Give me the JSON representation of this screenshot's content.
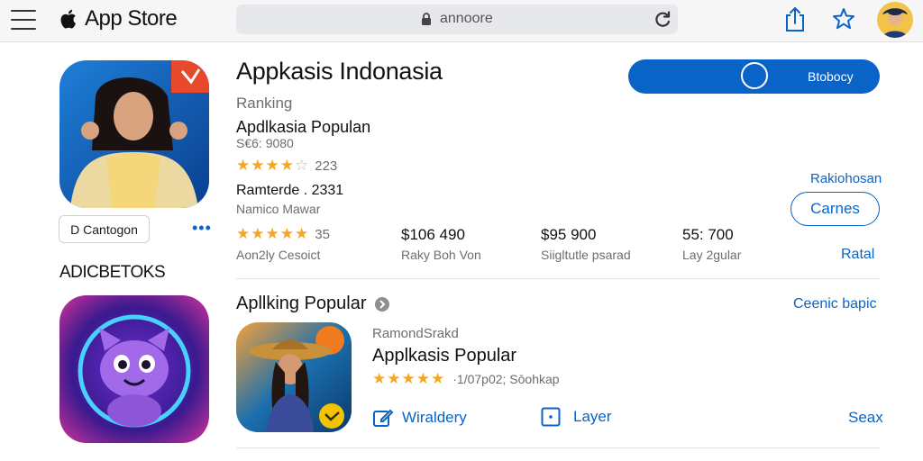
{
  "header": {
    "brand": "App Store",
    "url": "annoore",
    "icons": [
      "menu-icon",
      "apple-logo-icon",
      "lock-icon",
      "reload-icon",
      "share-icon",
      "favorite-star-icon",
      "avatar"
    ]
  },
  "featured": {
    "title": "Appkasis  Indonasia",
    "ranking_label": "Ranking",
    "subtitle": "Apdlkasia Populan",
    "meta": "S€6: 9080",
    "rating_count": "223",
    "rating_stars": 4,
    "developer": "Ramterde . 2331",
    "developer_sub": "Namico Mawar",
    "row_rating_count": "35",
    "row_rating_stars": 5,
    "get_button": "Btobocy",
    "side_link": "Rakiohosan",
    "outline_button": "Carnes",
    "side_link2": "Ratal"
  },
  "stats": [
    {
      "value": "$106 490",
      "label": "Raky Boh Von"
    },
    {
      "value": "$95 900",
      "label": "Siigltutle psarad"
    },
    {
      "value": "55: 700",
      "label": "Lay 2gular"
    }
  ],
  "stat_first_label": "Aon2ly Cesoict",
  "left": {
    "category_button": "Cantogon",
    "category_button_prefix": "D",
    "more": "•••",
    "section_title": "ADICBETOKS"
  },
  "list_section": {
    "title": "Apllking Popular",
    "link": "Ceenic bapic",
    "item": {
      "developer": "RamondSrakd",
      "name": "Applkasis Popular",
      "meta": "·1/07p02; Sōohkap",
      "rating_stars": 5,
      "action1": "Wiraldery",
      "action2": "Layer",
      "price": "Seax"
    }
  },
  "colors": {
    "accent": "#0a63c7",
    "star": "#f5a623",
    "text": "#1c1c1e",
    "muted": "#6d6d72"
  }
}
